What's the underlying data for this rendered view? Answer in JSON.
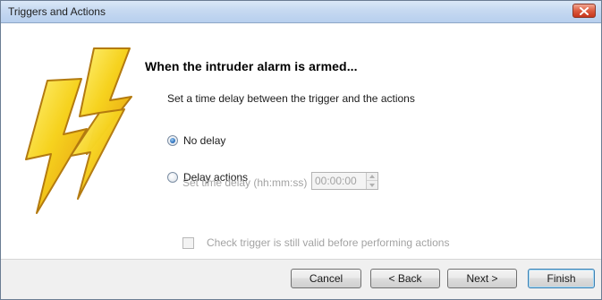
{
  "window": {
    "title": "Triggers and Actions",
    "close_icon": "close-icon"
  },
  "main": {
    "heading": "When the intruder alarm is armed...",
    "instruction": "Set a time delay between the trigger and the actions",
    "options": {
      "no_delay_label": "No delay",
      "no_delay_selected": true,
      "delay_actions_label": "Delay actions",
      "delay_actions_selected": false
    },
    "time_delay": {
      "label": "Set time delay (hh:mm:ss)",
      "value": "00:00:00",
      "enabled": false
    },
    "check_trigger": {
      "label": "Check trigger is still valid before performing actions",
      "checked": false,
      "enabled": false
    }
  },
  "footer": {
    "cancel_label": "Cancel",
    "back_label": "< Back",
    "next_label": "Next >",
    "finish_label": "Finish"
  },
  "colors": {
    "bolt_fill": "#f6d21e",
    "bolt_stroke": "#b37a0f",
    "title_bar": "#c6d9f1",
    "disabled_text": "#a3a3a3"
  },
  "icons": {
    "graphic": "lightning-bolts-icon"
  }
}
